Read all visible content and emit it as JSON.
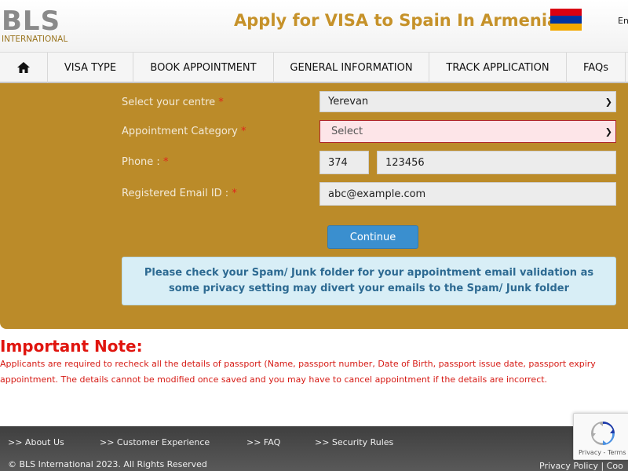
{
  "header": {
    "logo_main": "BLS",
    "logo_sub": "INTERNATIONAL",
    "title": "Apply for VISA to Spain In Armenia",
    "language": "En",
    "flag_colors": [
      "#d90012",
      "#0033a0",
      "#f2a800"
    ]
  },
  "nav": {
    "home_icon": "home-icon",
    "items": [
      "VISA TYPE",
      "BOOK APPOINTMENT",
      "GENERAL INFORMATION",
      "TRACK APPLICATION",
      "FAQs"
    ]
  },
  "form": {
    "centre_label": "Select your centre",
    "centre_value": "Yerevan",
    "category_label": "Appointment Category",
    "category_value": "Select",
    "phone_label": "Phone :",
    "phone_code": "374",
    "phone_number": "123456",
    "email_label": "Registered Email ID :",
    "email_value": "abc@example.com",
    "required_mark": "*",
    "continue_label": "Continue",
    "info_message": "Please check your Spam/ Junk folder for your appointment email validation as some privacy setting may divert your emails to the Spam/ Junk folder"
  },
  "note": {
    "title": "Important Note:",
    "line1": "Applicants are required to recheck all the details of passport (Name, passport number, Date of Birth, passport issue date, passport expiry",
    "line2": "appointment. The details cannot be modified once saved and you may have to cancel appointment if the details are incorrect."
  },
  "footer": {
    "links": [
      ">>  About Us",
      ">>  Customer Experience",
      ">>  FAQ",
      ">>  Security Rules"
    ],
    "copyright": "© BLS International 2023. All Rights Reserved",
    "policy": "Privacy Policy | Coo"
  },
  "recaptcha": {
    "terms": "Privacy - Terms"
  },
  "colors": {
    "gold_panel": "#bb8b29",
    "title_gold": "#c6922a",
    "button_blue": "#3a8fcf",
    "note_red": "#e0150f"
  }
}
